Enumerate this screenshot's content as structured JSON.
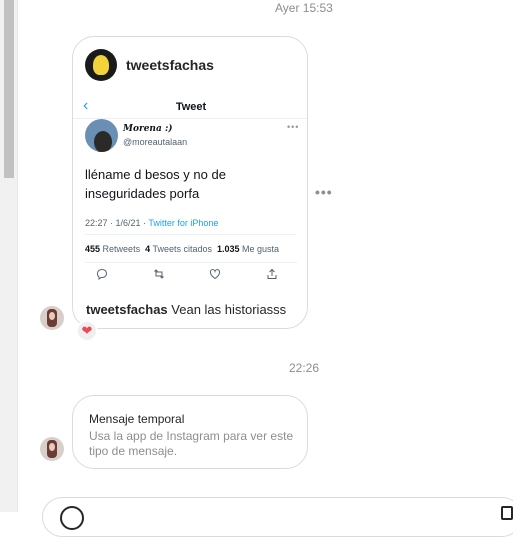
{
  "conversation": {
    "timestamps": [
      "Ayer 15:53",
      "22:26"
    ]
  },
  "shared_post": {
    "username": "tweetsfachas",
    "caption_username": "tweetsfachas",
    "caption_text": "Vean las historiasss",
    "tweet": {
      "header_title": "Tweet",
      "author_name": "𝑴𝒐𝒓𝒆𝒏𝒂 :)",
      "author_handle": "@moreautalaan",
      "text": "lléname d besos y no de inseguridades porfa",
      "time": "22:27 · 1/6/21 · ",
      "source": "Twitter for iPhone",
      "retweets_count": "455",
      "retweets_label": "Retweets",
      "quotes_count": "4",
      "quotes_label": "Tweets citados",
      "likes_count": "1.035",
      "likes_label": "Me gusta"
    },
    "reaction": "❤"
  },
  "temporary_message": {
    "title": "Mensaje temporal",
    "body": "Usa la app de Instagram para ver este tipo de mensaje."
  },
  "more_options": "•••",
  "colors": {
    "twitter_blue": "#1da1f2",
    "reaction_red": "#ed4956",
    "border": "#dbdbdb",
    "muted_text": "#8e8e8e"
  },
  "icons": [
    "more-options-icon",
    "back-arrow-icon",
    "reply-icon",
    "retweet-icon",
    "like-icon",
    "share-icon",
    "heart-reaction-icon",
    "emoji-icon",
    "attach-icon"
  ]
}
